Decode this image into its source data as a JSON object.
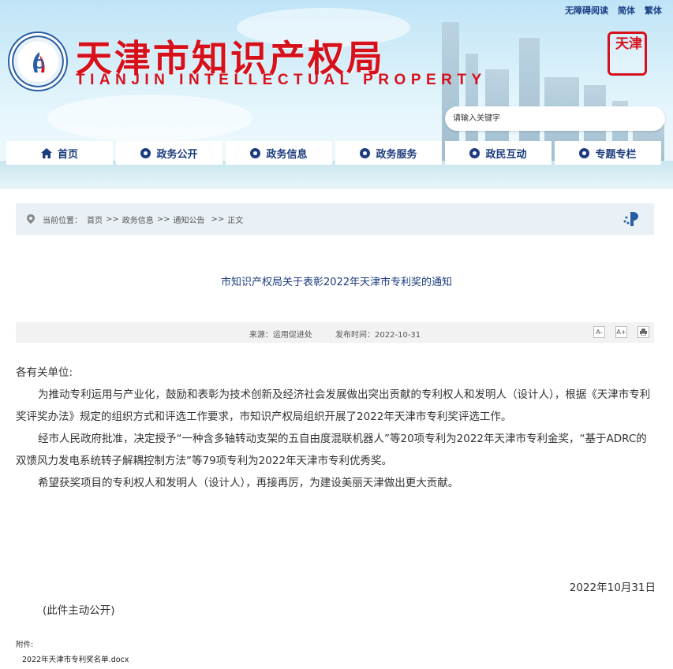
{
  "header": {
    "top_links": [
      "无障碍阅读",
      "简体",
      "繁体"
    ],
    "title_cn": "天津市知识产权局",
    "title_en": "TIANJIN INTELLECTUAL PROPERTY",
    "seal_text": "天津",
    "search_placeholder": "请输入关键字"
  },
  "nav": {
    "items": [
      {
        "label": "首页",
        "icon": "home-icon"
      },
      {
        "label": "政务公开",
        "icon": "open-icon"
      },
      {
        "label": "政务信息",
        "icon": "info-icon"
      },
      {
        "label": "政务服务",
        "icon": "service-icon"
      },
      {
        "label": "政民互动",
        "icon": "interact-icon"
      },
      {
        "label": "专题专栏",
        "icon": "topic-icon"
      }
    ]
  },
  "breadcrumb": {
    "prefix": "当前位置：",
    "items": [
      "首页",
      "政务信息",
      "通知公告",
      "正文"
    ],
    "sep": ">>"
  },
  "article": {
    "title": "市知识产权局关于表彰2022年天津市专利奖的通知",
    "source_label": "来源：",
    "source": "运用促进处",
    "date_label": "发布时间：",
    "date": "2022-10-31",
    "tools": [
      "A-",
      "A+",
      "print"
    ],
    "greeting": "各有关单位:",
    "paragraphs": [
      "为推动专利运用与产业化，鼓励和表彰为技术创新及经济社会发展做出突出贡献的专利权人和发明人（设计人），根据《天津市专利奖评奖办法》规定的组织方式和评选工作要求，市知识产权局组织开展了2022年天津市专利奖评选工作。",
      "经市人民政府批准，决定授予“一种含多轴转动支架的五自由度混联机器人”等20项专利为2022年天津市专利金奖，“基于ADRC的双馈风力发电系统转子解耦控制方法”等79项专利为2022年天津市专利优秀奖。",
      "希望获奖项目的专利权人和发明人（设计人），再接再厉，为建设美丽天津做出更大贡献。"
    ],
    "sign_date": "2022年10月31日",
    "public_note": "(此件主动公开)",
    "attachment_label": "附件:",
    "attachment_file": "2022年天津市专利奖名单.docx"
  },
  "colors": {
    "brand_red": "#d7111c",
    "nav_blue": "#1c3c7e"
  }
}
